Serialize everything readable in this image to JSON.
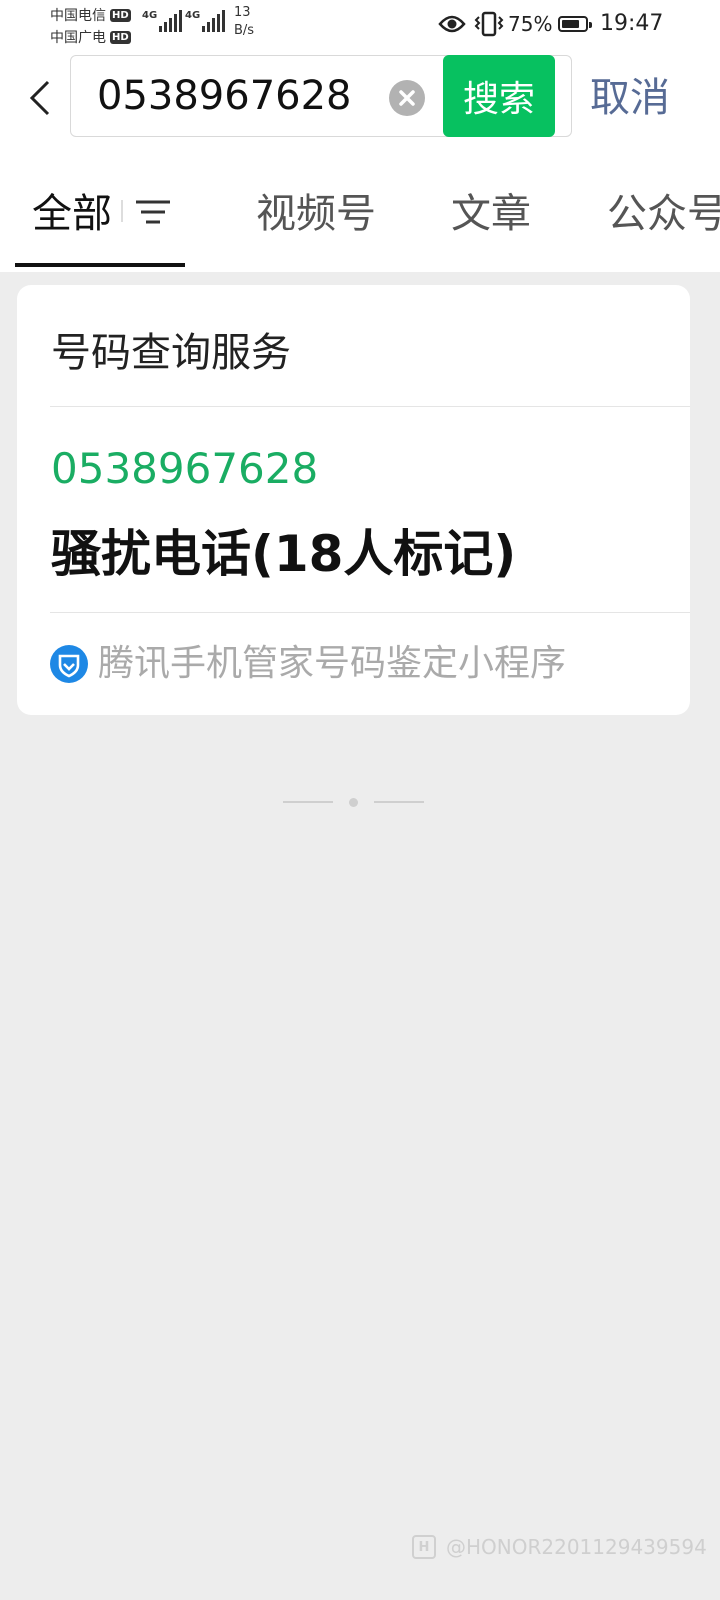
{
  "status_bar": {
    "carrier1": "中国电信",
    "carrier2": "中国广电",
    "hd_badge": "HD",
    "network1": "4G",
    "network2": "4G",
    "speed_value": "13",
    "speed_unit": "B/s",
    "battery_percent": "75%",
    "battery_level": 0.75,
    "time": "19:47",
    "icons": [
      "eye-icon",
      "vibrate-icon",
      "battery-icon"
    ]
  },
  "search": {
    "query": "0538967628",
    "button_label": "搜索",
    "cancel_label": "取消"
  },
  "tabs": [
    {
      "label": "全部",
      "active": true
    },
    {
      "label": "视频号",
      "active": false
    },
    {
      "label": "文章",
      "active": false
    },
    {
      "label": "公众号",
      "active": false
    }
  ],
  "result_card": {
    "title": "号码查询服务",
    "number": "0538967628",
    "tag": "骚扰电话(18人标记)",
    "source": "腾讯手机管家号码鉴定小程序"
  },
  "colors": {
    "accent_green": "#07c160",
    "number_green": "#1aad63",
    "link_blue": "#576b95",
    "background": "#ededed"
  },
  "watermark": {
    "logo": "H",
    "text": "@HONOR2201129439594"
  }
}
